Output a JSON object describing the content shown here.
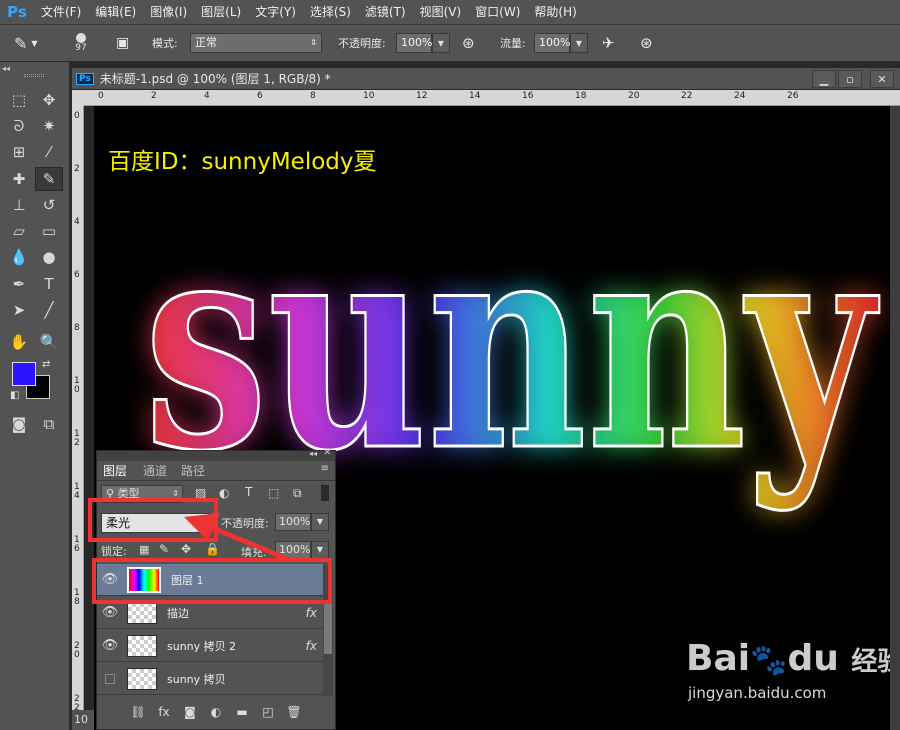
{
  "app": {
    "logo": "Ps"
  },
  "menu": [
    "文件(F)",
    "编辑(E)",
    "图像(I)",
    "图层(L)",
    "文字(Y)",
    "选择(S)",
    "滤镜(T)",
    "视图(V)",
    "窗口(W)",
    "帮助(H)"
  ],
  "options": {
    "brush_size": "97",
    "mode_label": "模式:",
    "mode_value": "正常",
    "opacity_label": "不透明度:",
    "opacity_value": "100%",
    "flow_label": "流量:",
    "flow_value": "100%"
  },
  "document": {
    "title": "未标题-1.psd @ 100% (图层 1, RGB/8) *"
  },
  "ruler_h": [
    "0",
    "2",
    "4",
    "6",
    "8",
    "10",
    "12",
    "14",
    "16",
    "18",
    "20",
    "22",
    "24",
    "26"
  ],
  "ruler_v": [
    "0",
    "2",
    "4",
    "6",
    "8",
    "1\n0",
    "1\n2",
    "1\n4",
    "1\n6",
    "1\n8",
    "2\n0",
    "2\n2"
  ],
  "canvas": {
    "caption": "百度ID：sunnyMelody夏",
    "art_text": "sunny"
  },
  "layers_panel": {
    "tabs": [
      "图层",
      "通道",
      "路径"
    ],
    "filter_kind": "类型",
    "blend_mode": "柔光",
    "opacity_label": "不透明度:",
    "opacity_value": "100%",
    "lock_label": "锁定:",
    "fill_label": "填充:",
    "fill_value": "100%",
    "layers": [
      {
        "name": "图层 1",
        "visible": true,
        "selected": true,
        "fx": false
      },
      {
        "name": "描边",
        "visible": true,
        "selected": false,
        "fx": true
      },
      {
        "name": "sunny 拷贝 2",
        "visible": true,
        "selected": false,
        "fx": true
      },
      {
        "name": "sunny 拷贝",
        "visible": false,
        "selected": false,
        "fx": false
      }
    ]
  },
  "status": {
    "zoom": "10"
  },
  "watermark": {
    "brand_a": "Bai",
    "brand_b": "du",
    "brand_cn": "经验",
    "url": "jingyan.baidu.com"
  },
  "colors": {
    "foreground": "#2b14ff",
    "background": "#000000",
    "highlight": "#ee3333",
    "caption": "#f6f000"
  }
}
